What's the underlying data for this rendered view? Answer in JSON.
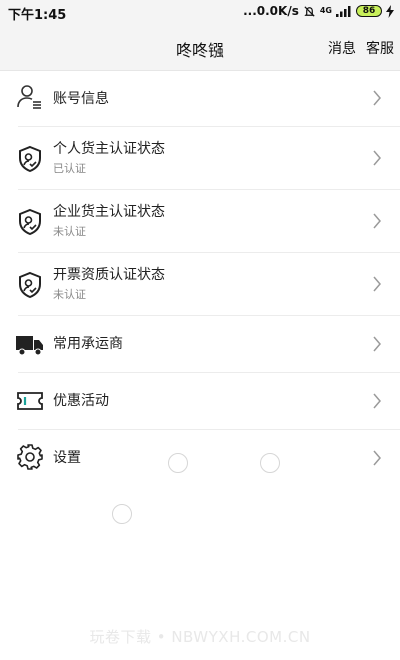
{
  "status_bar": {
    "time": "下午1:45",
    "network_speed": "...0.0K/s",
    "network_type": "4G",
    "battery_level": "86"
  },
  "header": {
    "title": "咚咚镪",
    "messages_label": "消息",
    "service_label": "客服"
  },
  "menu": {
    "items": [
      {
        "icon": "user-list-icon",
        "title": "账号信息"
      },
      {
        "icon": "shield-badge-icon",
        "title": "个人货主认证状态",
        "subtitle": "已认证"
      },
      {
        "icon": "shield-badge-icon",
        "title": "企业货主认证状态",
        "subtitle": "未认证"
      },
      {
        "icon": "shield-badge-icon",
        "title": "开票资质认证状态",
        "subtitle": "未认证"
      },
      {
        "icon": "truck-icon",
        "title": "常用承运商"
      },
      {
        "icon": "ticket-icon",
        "title": "优惠活动"
      },
      {
        "icon": "gear-icon",
        "title": "设置"
      }
    ]
  },
  "watermark": "玩卷下载 • NBWYXH.COM.CN",
  "colors": {
    "status_bar_bg": "#f4f4f4",
    "battery": "#c8f05a",
    "divider": "#ececec",
    "subtitle": "#888888",
    "chevron": "#9a9a9a"
  }
}
